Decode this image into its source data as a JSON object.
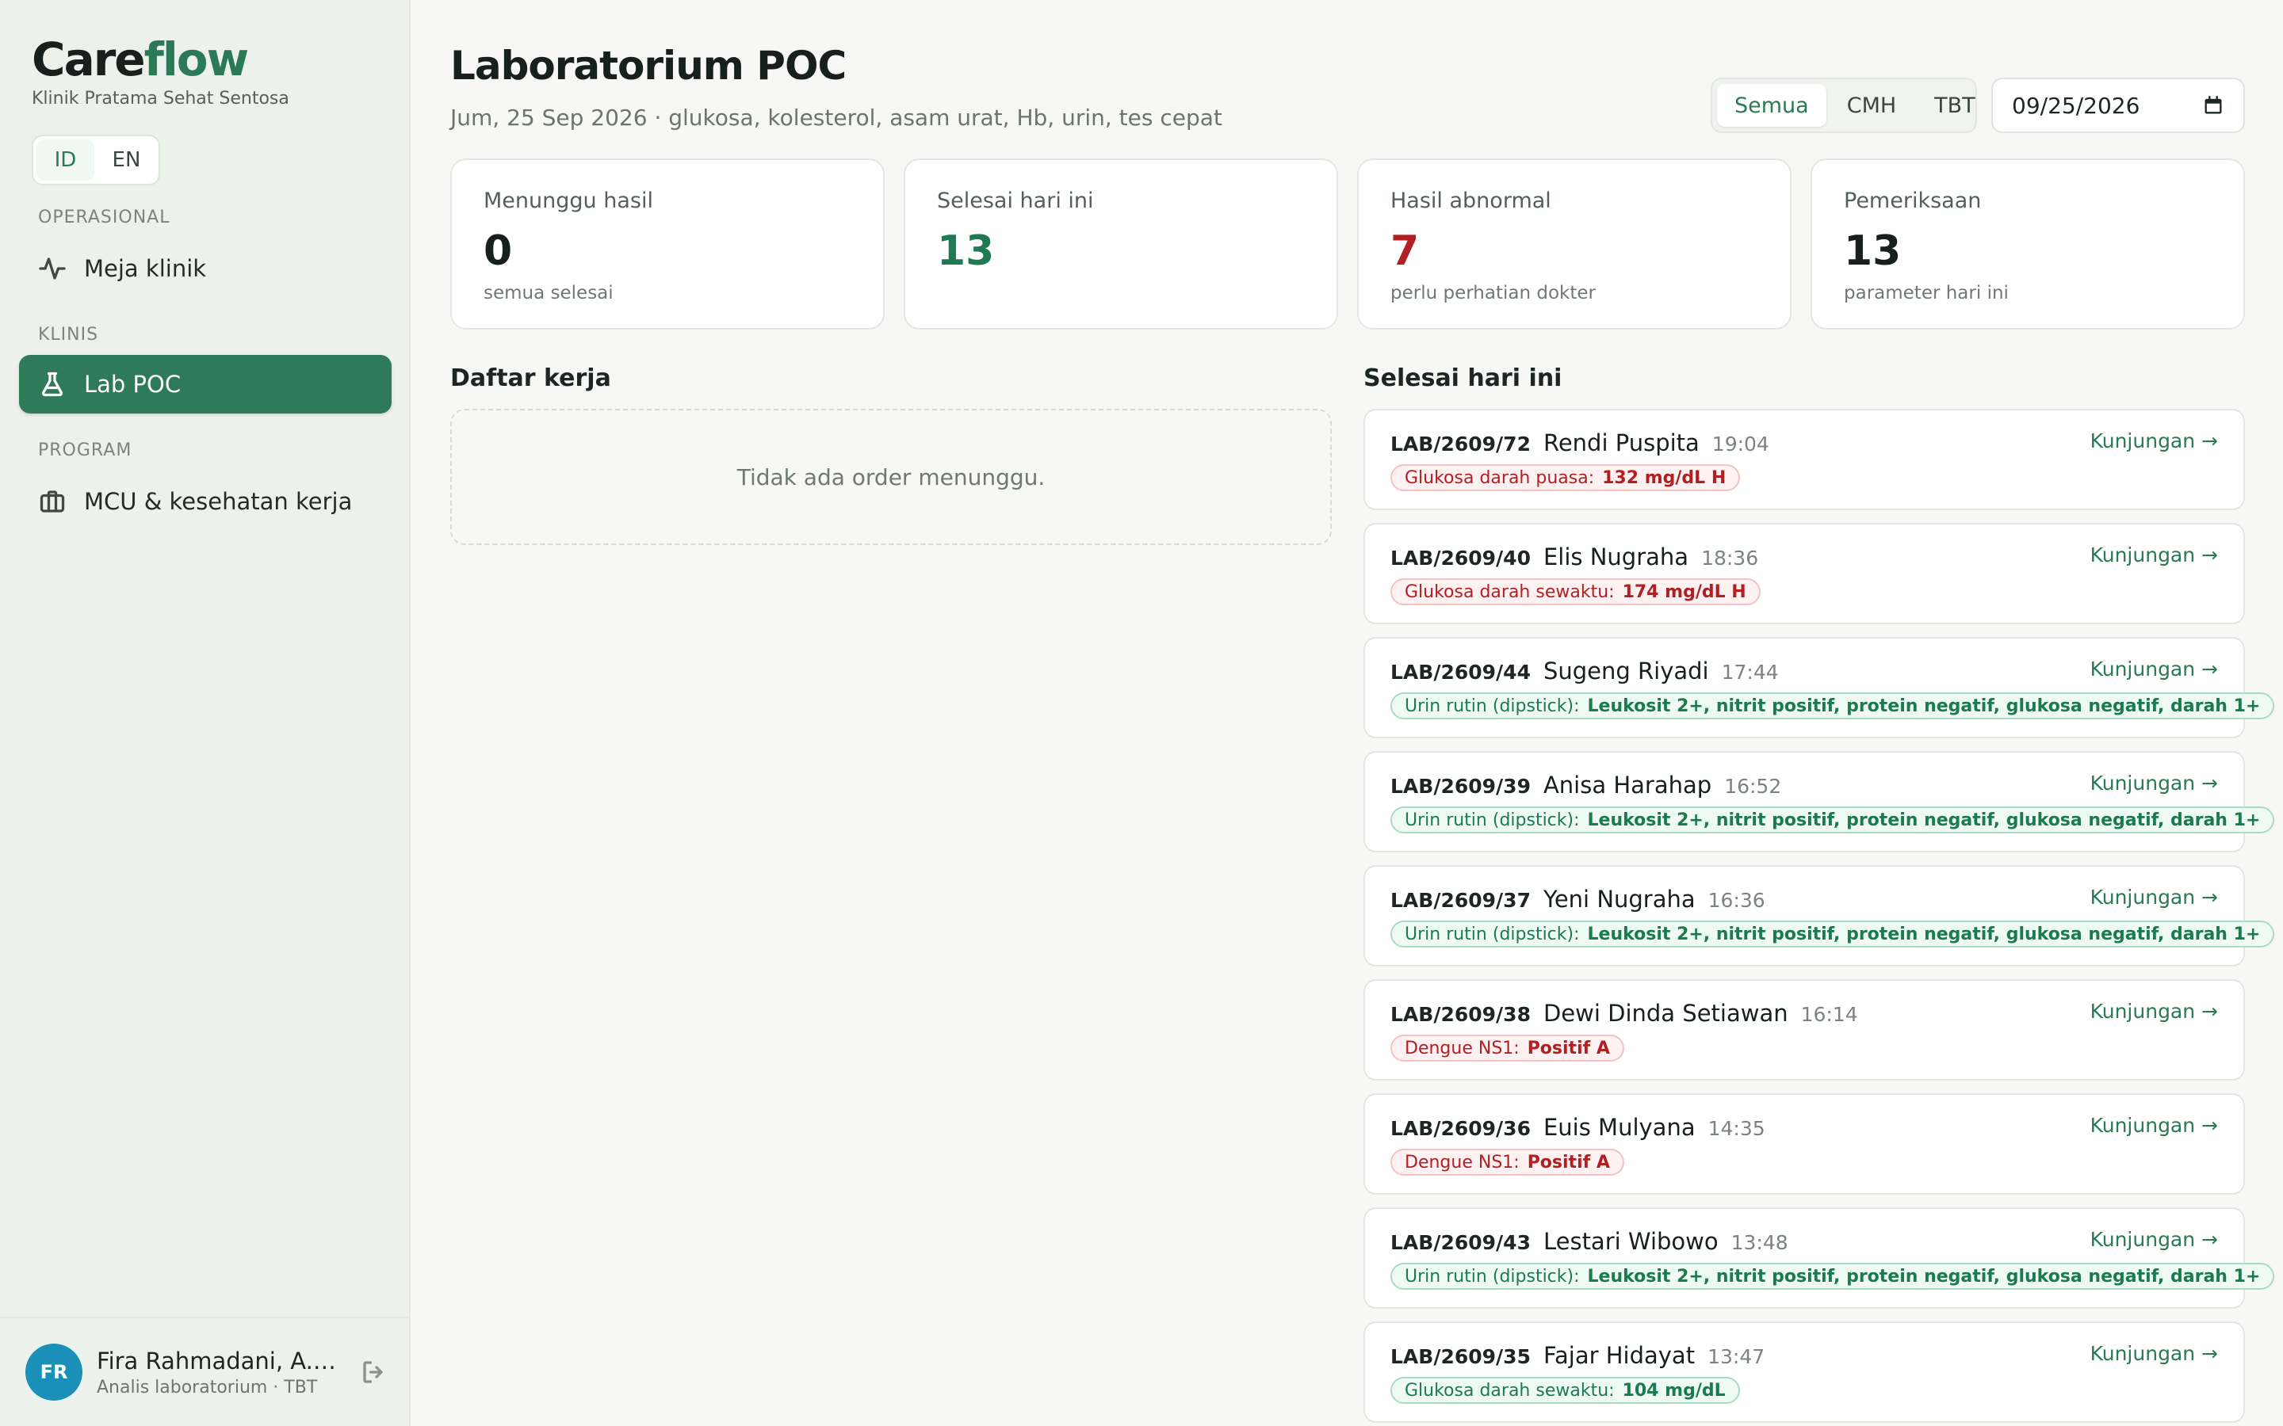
{
  "brand": {
    "part1": "Care",
    "part2": "flow",
    "subtitle": "Klinik Pratama Sehat Sentosa"
  },
  "lang": {
    "id": "ID",
    "en": "EN"
  },
  "nav": {
    "section_operasional": "OPERASIONAL",
    "meja_klinik": "Meja klinik",
    "section_klinis": "KLINIS",
    "lab_poc": "Lab POC",
    "section_program": "PROGRAM",
    "mcu": "MCU & kesehatan kerja"
  },
  "user": {
    "initials": "FR",
    "name": "Fira Rahmadani, A.Md.AK",
    "role": "Analis laboratorium · TBT"
  },
  "header": {
    "title": "Laboratorium POC",
    "subtitle": "Jum, 25 Sep 2026 · glukosa, kolesterol, asam urat, Hb, urin, tes cepat",
    "filters": [
      "Semua",
      "CMH",
      "TBT"
    ],
    "date": "09/25/2026"
  },
  "stats": [
    {
      "label": "Menunggu hasil",
      "value": "0",
      "hint": "semua selesai",
      "color": "#17201c"
    },
    {
      "label": "Selesai hari ini",
      "value": "13",
      "hint": "",
      "color": "#1f7a53"
    },
    {
      "label": "Hasil abnormal",
      "value": "7",
      "hint": "perlu perhatian dokter",
      "color": "#b21f23"
    },
    {
      "label": "Pemeriksaan",
      "value": "13",
      "hint": "parameter hari ini",
      "color": "#17201c"
    }
  ],
  "worklist": {
    "title": "Daftar kerja",
    "empty": "Tidak ada order menunggu."
  },
  "done": {
    "title": "Selesai hari ini",
    "link_label": "Kunjungan →",
    "items": [
      {
        "id": "LAB/2609/72",
        "name": "Rendi Puspita",
        "time": "19:04",
        "test": "Glukosa darah puasa:",
        "result": "132 mg/dL  H",
        "abnormal": true
      },
      {
        "id": "LAB/2609/40",
        "name": "Elis Nugraha",
        "time": "18:36",
        "test": "Glukosa darah sewaktu:",
        "result": "174 mg/dL  H",
        "abnormal": true
      },
      {
        "id": "LAB/2609/44",
        "name": "Sugeng Riyadi",
        "time": "17:44",
        "test": "Urin rutin (dipstick):",
        "result": "Leukosit 2+, nitrit positif, protein negatif, glukosa negatif, darah 1+",
        "abnormal": false
      },
      {
        "id": "LAB/2609/39",
        "name": "Anisa Harahap",
        "time": "16:52",
        "test": "Urin rutin (dipstick):",
        "result": "Leukosit 2+, nitrit positif, protein negatif, glukosa negatif, darah 1+",
        "abnormal": false
      },
      {
        "id": "LAB/2609/37",
        "name": "Yeni Nugraha",
        "time": "16:36",
        "test": "Urin rutin (dipstick):",
        "result": "Leukosit 2+, nitrit positif, protein negatif, glukosa negatif, darah 1+",
        "abnormal": false
      },
      {
        "id": "LAB/2609/38",
        "name": "Dewi Dinda Setiawan",
        "time": "16:14",
        "test": "Dengue NS1:",
        "result": "Positif  A",
        "abnormal": true
      },
      {
        "id": "LAB/2609/36",
        "name": "Euis Mulyana",
        "time": "14:35",
        "test": "Dengue NS1:",
        "result": "Positif  A",
        "abnormal": true
      },
      {
        "id": "LAB/2609/43",
        "name": "Lestari Wibowo",
        "time": "13:48",
        "test": "Urin rutin (dipstick):",
        "result": "Leukosit 2+, nitrit positif, protein negatif, glukosa negatif, darah 1+",
        "abnormal": false
      },
      {
        "id": "LAB/2609/35",
        "name": "Fajar Hidayat",
        "time": "13:47",
        "test": "Glukosa darah sewaktu:",
        "result": "104 mg/dL",
        "abnormal": false
      }
    ]
  }
}
